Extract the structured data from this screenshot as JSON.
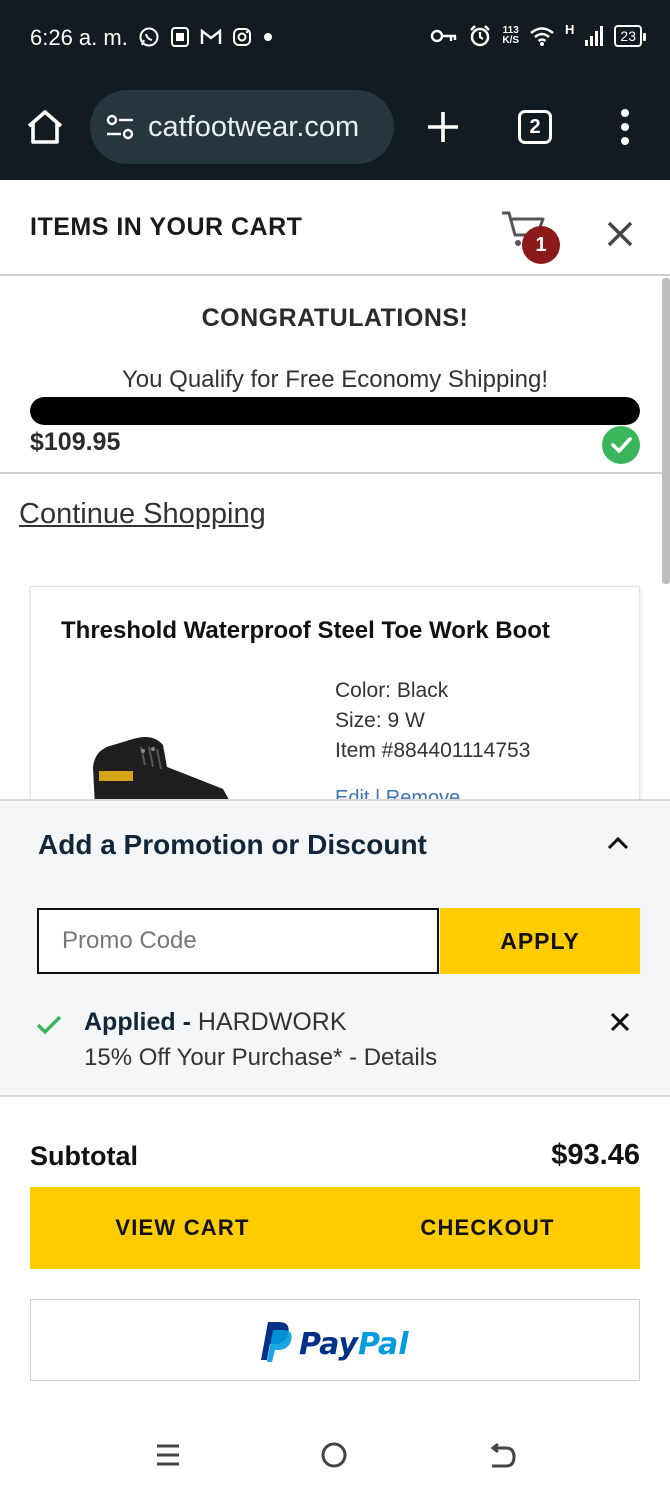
{
  "status_bar": {
    "time": "6:26 a. m.",
    "net_speed_value": "113",
    "net_speed_unit": "K/S",
    "network_type": "H",
    "battery": "23",
    "icons": [
      "whatsapp-icon",
      "sim-icon",
      "gmail-icon",
      "instagram-icon",
      "dot-icon",
      "key-icon",
      "alarm-icon",
      "wifi-icon",
      "signal-icon",
      "battery-icon"
    ]
  },
  "browser": {
    "url": "catfootwear.com",
    "tab_count": "2"
  },
  "cart": {
    "title": "ITEMS IN YOUR CART",
    "count": "1"
  },
  "shipping": {
    "title": "CONGRATULATIONS!",
    "message": "You Qualify for Free Economy Shipping!",
    "progress": 1.0,
    "threshold": "$109.95"
  },
  "continue_shopping": "Continue Shopping",
  "product": {
    "name": "Threshold Waterproof Steel Toe Work Boot",
    "color": "Color: Black",
    "size": "Size: 9 W",
    "item_number": "Item #884401114753",
    "actions": "Edit | Remove"
  },
  "promo": {
    "title": "Add a Promotion or Discount",
    "placeholder": "Promo Code",
    "apply_label": "APPLY",
    "applied_label": "Applied",
    "applied_separator": " - ",
    "applied_code": "HARDWORK",
    "detail": "15% Off Your Purchase* - Details"
  },
  "totals": {
    "subtotal_label": "Subtotal",
    "subtotal_value": "$93.46"
  },
  "actions": {
    "view_cart": "VIEW CART",
    "checkout": "CHECKOUT",
    "paypal": "PayPal"
  },
  "colors": {
    "accent_yellow": "#ffcc00",
    "badge_red": "#8b1a1a",
    "success_green": "#3bb55c",
    "dark_bar": "#111b21"
  }
}
